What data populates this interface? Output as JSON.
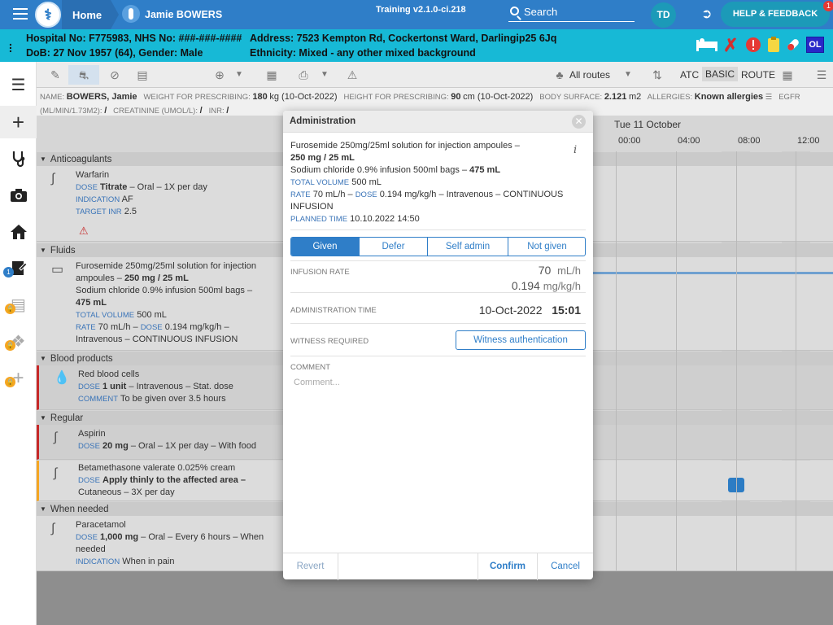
{
  "topbar": {
    "home_label": "Home",
    "patient_name": "Jamie BOWERS",
    "version": "Training v2.1.0-ci.218",
    "search_label": "Search",
    "user_initials": "TD",
    "help_label": "HELP & FEEDBACK",
    "help_badge": "1"
  },
  "patient": {
    "line1_left": "Hospital No: F775983, NHS No: ###-###-####",
    "line2_left": "DoB: 27 Nov 1957 (64), Gender: Male",
    "line1_right": "Address: 7523 Kempton Rd, Cockertonst Ward, Darlingip25 6Jq",
    "line2_right": "Ethnicity: Mixed - any other mixed background",
    "icon_initials": "OL"
  },
  "sidebar": {
    "badge_count": "1"
  },
  "toolbar": {
    "routes_label": "All routes",
    "atc_label": "ATC",
    "basic_label": "BASIC",
    "route_label": "ROUTE"
  },
  "info": {
    "name_label": "NAME:",
    "name_value": "BOWERS, Jamie",
    "weight_label": "WEIGHT FOR PRESCRIBING:",
    "weight_value": "180",
    "weight_rest": "kg (10-Oct-2022)",
    "height_label": "HEIGHT FOR PRESCRIBING:",
    "height_value": "90",
    "height_rest": "cm (10-Oct-2022)",
    "body_label": "BODY SURFACE:",
    "body_value": "2.121",
    "body_unit": "m2",
    "allergies_label": "ALLERGIES:",
    "allergies_value": "Known allergies",
    "egfr_label": "EGFR",
    "egfr_unit_label": "(ML/MIN/1.73M2):",
    "egfr_value": "/",
    "creat_label": "CREATININE (UMOL/L):",
    "creat_value": "/",
    "inr_label": "INR:",
    "inr_value": "/"
  },
  "timeline": {
    "date": "Tue 11 October",
    "hours": [
      "00:00",
      "04:00",
      "08:00",
      "12:00"
    ]
  },
  "sections": [
    "Anticoagulants",
    "Fluids",
    "Blood products",
    "Regular",
    "When needed"
  ],
  "meds": {
    "warfarin": {
      "name": "Warfarin",
      "dose_k": "DOSE",
      "dose": "Titrate",
      "dose_rest": " – Oral – 1X per day",
      "ind_k": "INDICATION",
      "ind": "AF",
      "inr_k": "TARGET INR",
      "inr": "2.5"
    },
    "furosemide": {
      "line1": "Furosemide 250mg/25ml solution for injection",
      "line2a": "ampoules – ",
      "line2b": "250 mg / 25 mL",
      "line3": "Sodium chloride 0.9% infusion 500ml bags –",
      "line4": "475 mL",
      "vol_k": "TOTAL VOLUME",
      "vol": "500 mL",
      "rate_k": "RATE",
      "rate": "70 mL/h – ",
      "rdose_k": "DOSE",
      "rdose": "0.194 mg/kg/h –",
      "line_last": "Intravenous – CONTINUOUS INFUSION"
    },
    "redcells": {
      "name": "Red blood cells",
      "dose_k": "DOSE",
      "dose": "1 unit",
      "dose_rest": " – Intravenous – Stat. dose",
      "comment_k": "COMMENT",
      "comment": "To be given over 3.5 hours"
    },
    "aspirin": {
      "name": "Aspirin",
      "dose_k": "DOSE",
      "dose": "20 mg",
      "dose_rest": " – Oral – 1X per day – With food"
    },
    "betamethasone": {
      "name": "Betamethasone valerate 0.025% cream",
      "dose_k": "DOSE",
      "dose": "Apply thinly to the affected area –",
      "line3": "Cutaneous – 3X per day"
    },
    "paracetamol": {
      "name": "Paracetamol",
      "dose_k": "DOSE",
      "dose": "1,000 mg",
      "dose_rest": " – Oral – Every 6 hours – When",
      "line3": "needed",
      "ind_k": "INDICATION",
      "ind": "When in pain"
    }
  },
  "modal": {
    "title": "Administration",
    "drug_line1": "Furosemide 250mg/25ml solution for injection ampoules –",
    "drug_line2": "250 mg / 25 mL",
    "drug_line3a": "Sodium chloride 0.9% infusion 500ml bags – ",
    "drug_line3b": "475 mL",
    "vol_k": "TOTAL VOLUME",
    "vol": "500 mL",
    "rate_k": "RATE",
    "rate": "70 mL/h – ",
    "dose_k": "DOSE",
    "dose": "0.194 mg/kg/h – Intravenous – CONTINUOUS",
    "dose_line2": "INFUSION",
    "planned_k": "PLANNED TIME",
    "planned": "10.10.2022 14:50",
    "tabs": [
      "Given",
      "Defer",
      "Self admin",
      "Not given"
    ],
    "infusion_rate_label": "INFUSION RATE",
    "rate_value": "70",
    "rate_unit": "mL/h",
    "dose_value": "0.194",
    "dose_unit": "mg/kg/h",
    "admin_time_label": "ADMINISTRATION TIME",
    "admin_date": "10-Oct-2022",
    "admin_time": "15:01",
    "witness_label": "WITNESS REQUIRED",
    "witness_button": "Witness authentication",
    "comment_label": "COMMENT",
    "comment_placeholder": "Comment...",
    "revert": "Revert",
    "confirm": "Confirm",
    "cancel": "Cancel"
  }
}
